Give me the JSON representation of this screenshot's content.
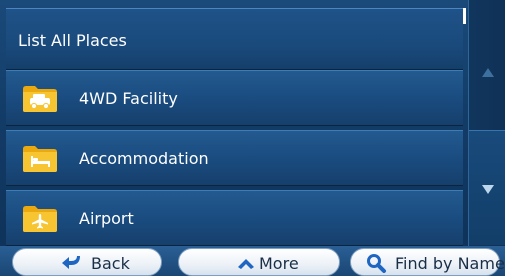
{
  "header": {
    "title": "List All Places"
  },
  "items": [
    {
      "label": "4WD Facility",
      "icon": "car-icon"
    },
    {
      "label": "Accommodation",
      "icon": "bed-icon"
    },
    {
      "label": "Airport",
      "icon": "airplane-icon"
    }
  ],
  "scrollbar": {
    "up_icon": "chevron-up-icon",
    "down_icon": "chevron-down-icon"
  },
  "bottom": {
    "back_label": "Back",
    "more_label": "More",
    "find_label": "Find by Name"
  },
  "colors": {
    "background": "#123b66",
    "folder": "#f0b81c",
    "button_text": "#1a2f47",
    "icon_blue": "#1f66c2"
  }
}
